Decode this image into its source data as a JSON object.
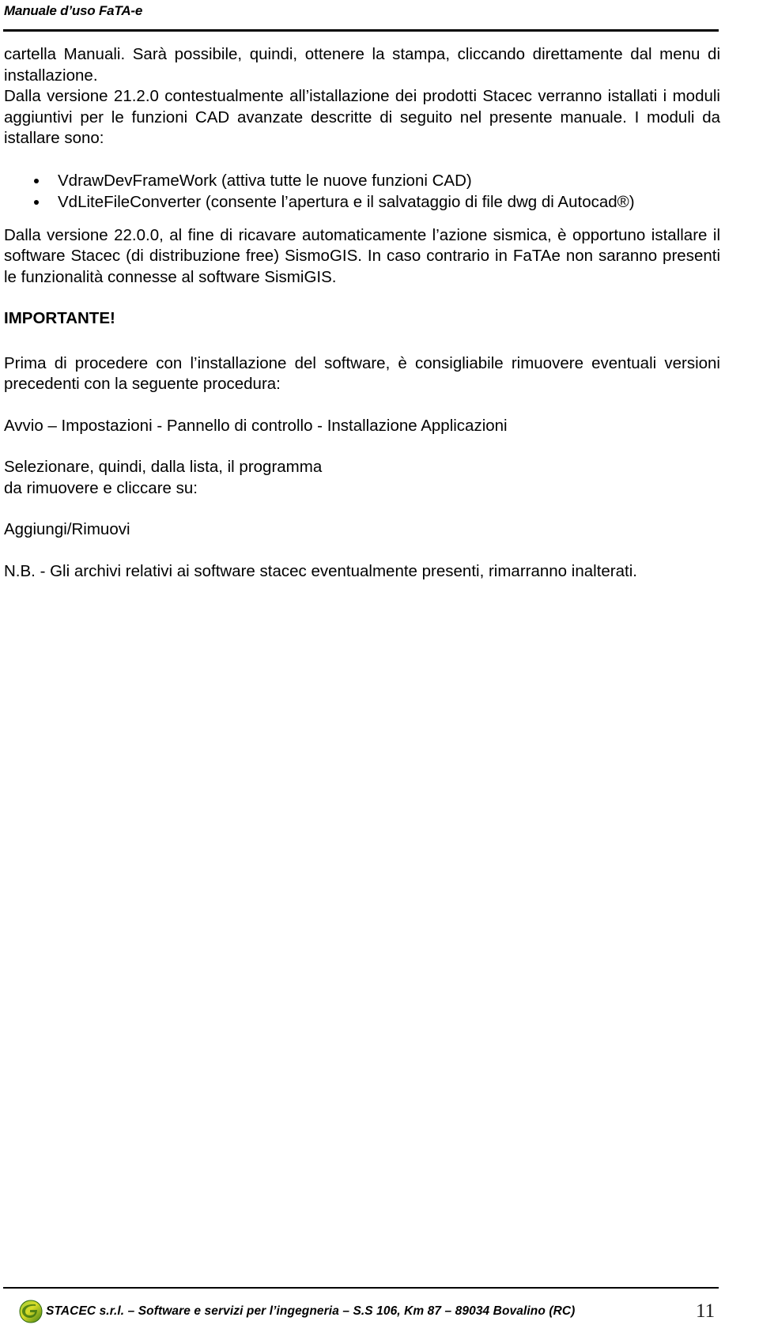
{
  "header": {
    "title": "Manuale d’uso FaTA-e"
  },
  "body": {
    "paragraph_1": "cartella Manuali. Sarà possibile, quindi, ottenere la stampa, cliccando direttamente dal menu di installazione.",
    "paragraph_2": "Dalla versione 21.2.0 contestualmente all’istallazione dei prodotti Stacec verranno istallati i moduli aggiuntivi per le funzioni CAD avanzate descritte di seguito nel presente manuale. I moduli da istallare sono:",
    "bullets": [
      "VdrawDevFrameWork (attiva tutte le nuove funzioni CAD)",
      "VdLiteFileConverter (consente l’apertura e il salvataggio di file dwg di Autocad®)"
    ],
    "paragraph_3": "Dalla versione 22.0.0, al fine di ricavare automaticamente l’azione sismica, è opportuno istallare il software Stacec (di distribuzione free) SismoGIS. In caso contrario in FaTAe non saranno presenti le funzionalità connesse al software SismiGIS.",
    "important_heading": "IMPORTANTE!",
    "paragraph_4": "Prima di procedere con l’installazione del software, è consigliabile rimuovere eventuali versioni precedenti con la seguente procedura:",
    "paragraph_5": "Avvio – Impostazioni - Pannello di controllo - Installazione Applicazioni",
    "paragraph_6_line_1": "Selezionare, quindi, dalla lista, il programma",
    "paragraph_6_line_2": "da rimuovere e cliccare su:",
    "paragraph_7": "Aggiungi/Rimuovi",
    "paragraph_8": "N.B.  -  Gli  archivi  relativi  ai  software  stacec  eventualmente  presenti,  rimarranno  inalterati."
  },
  "footer": {
    "logo_icon": "stacec-leaf-logo-icon",
    "text": "STACEC s.r.l. – Software e servizi per l’ingegneria  –  S.S 106, Km 87 – 89034 Bovalino (RC)",
    "page_number": "11"
  },
  "colors": {
    "text": "#000000",
    "rule": "#000000",
    "logo_green": "#4e9a1f",
    "logo_yellow": "#d8dc28",
    "page_background": "#ffffff"
  }
}
